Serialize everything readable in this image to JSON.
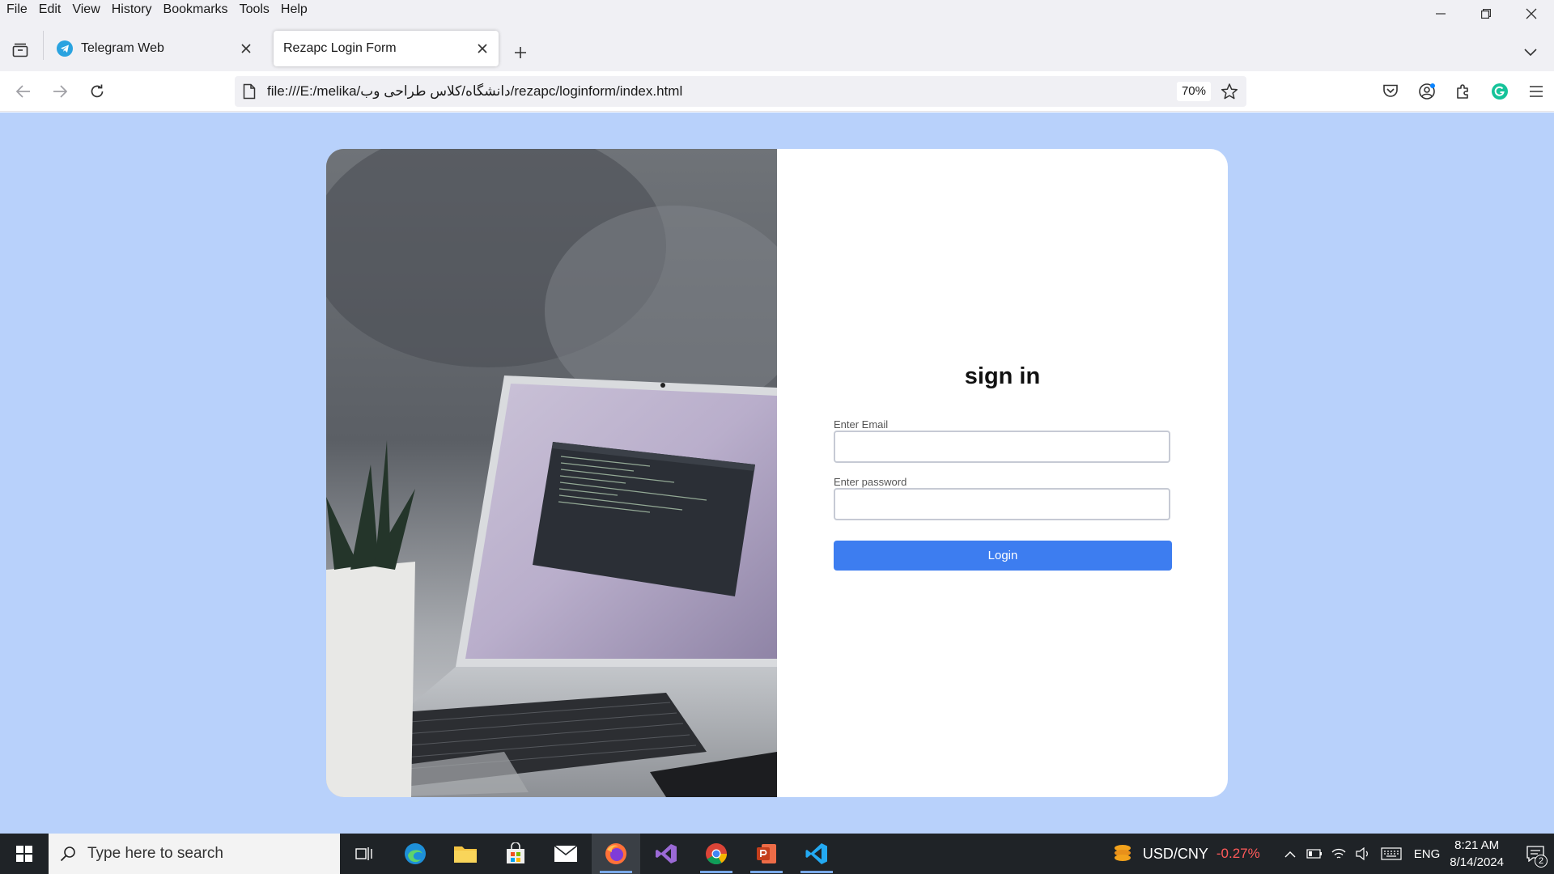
{
  "menubar": {
    "items": [
      "File",
      "Edit",
      "View",
      "History",
      "Bookmarks",
      "Tools",
      "Help"
    ]
  },
  "tabs": [
    {
      "title": "Telegram Web",
      "active": false,
      "favicon": "telegram-icon"
    },
    {
      "title": "Rezapc Login Form",
      "active": true,
      "favicon": ""
    }
  ],
  "navbar": {
    "url": "file:///E:/melika/دانشگاه/کلاس طراحی وب/rezapc/loginform/index.html",
    "zoom": "70%"
  },
  "page": {
    "title": "sign in",
    "email_label": "Enter Email",
    "email_value": "",
    "password_label": "Enter password",
    "password_value": "",
    "login_label": "Login",
    "background_color": "#b8d1fb",
    "button_color": "#3d7df0"
  },
  "taskbar": {
    "search_placeholder": "Type here to search",
    "ticker_symbol": "USD/CNY",
    "ticker_change": "-0.27%",
    "language": "ENG",
    "time": "8:21 AM",
    "date": "8/14/2024",
    "notification_count": "2",
    "apps": [
      "task-view-icon",
      "edge-icon",
      "file-explorer-icon",
      "store-icon",
      "mail-icon",
      "firefox-icon",
      "visual-studio-icon",
      "chrome-icon",
      "powerpoint-icon",
      "vscode-icon"
    ]
  }
}
